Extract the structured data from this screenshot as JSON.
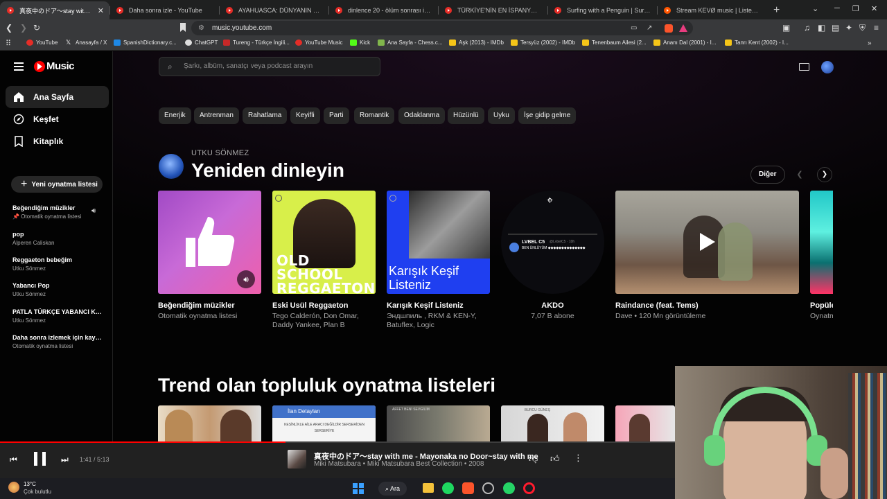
{
  "browser": {
    "tabs": [
      {
        "title": "真夜中のドア〜stay with me",
        "active": true
      },
      {
        "title": "Daha sonra izle - YouTube"
      },
      {
        "title": "AYAHUASCA: DÜNYANIN EN GÜÇLÜ"
      },
      {
        "title": "dinlence 20 - ölüm sonrası ihtimalle"
      },
      {
        "title": "TÜRKİYE'NİN EN İSPANYOL FUTBOL"
      },
      {
        "title": "Surfing with a Penguin | Surf's Up fo"
      },
      {
        "title": "Stream KEVØ music | Listen to song"
      }
    ],
    "new_tab": "+",
    "url": "music.youtube.com",
    "bookmarks": [
      {
        "label": "YouTube",
        "color": "#e52d27"
      },
      {
        "label": "Anasayfa / X",
        "color": "#000000"
      },
      {
        "label": "SpanishDictionary.c...",
        "color": "#1e88e5"
      },
      {
        "label": "ChatGPT",
        "color": "#dddddd"
      },
      {
        "label": "Tureng - Türkçe İngili...",
        "color": "#c62828"
      },
      {
        "label": "YouTube Music",
        "color": "#e52d27"
      },
      {
        "label": "Kick",
        "color": "#53fc18"
      },
      {
        "label": "Ana Sayfa - Chess.c...",
        "color": "#81b64c"
      },
      {
        "label": "Aşk (2013) - IMDb",
        "color": "#f5c518"
      },
      {
        "label": "Tersyüz (2002) - IMDb",
        "color": "#f5c518"
      },
      {
        "label": "Tenenbaum Ailesi (2...",
        "color": "#f5c518"
      },
      {
        "label": "Ananı Dal (2001) - I...",
        "color": "#f5c518"
      },
      {
        "label": "Tanrı Kent (2002) - I...",
        "color": "#f5c518"
      }
    ]
  },
  "app": {
    "logo": "Music",
    "nav": [
      {
        "label": "Ana Sayfa",
        "icon": "home-icon",
        "active": true
      },
      {
        "label": "Keşfet",
        "icon": "explore-icon"
      },
      {
        "label": "Kitaplık",
        "icon": "library-icon"
      }
    ],
    "new_playlist": "Yeni oynatma listesi",
    "playlists": [
      {
        "title": "Beğendiğim müzikler",
        "subtitle": "Otomatik oynatma listesi"
      },
      {
        "title": "pop",
        "subtitle": "Alperen Caliskan"
      },
      {
        "title": "Reggaeton bebeğim",
        "subtitle": "Utku Sönmez"
      },
      {
        "title": "Yabancı Pop",
        "subtitle": "Utku Sönmez"
      },
      {
        "title": "PATLA TÜRKÇE YABANCI KA...",
        "subtitle": "Utku Sönmez"
      },
      {
        "title": "Daha sonra izlemek için kayd...",
        "subtitle": "Otomatik oynatma listesi"
      }
    ],
    "search_placeholder": "Şarkı, albüm, sanatçı veya podcast arayın",
    "chips": [
      "Enerjik",
      "Antrenman",
      "Rahatlama",
      "Keyifli",
      "Parti",
      "Romantik",
      "Odaklanma",
      "Hüzünlü",
      "Uyku",
      "İşe gidip gelme"
    ],
    "section1": {
      "user": "UTKU SÖNMEZ",
      "title": "Yeniden dinleyin",
      "more": "Diğer",
      "cards": [
        {
          "title": "Beğendiğim müzikler",
          "subtitle": "Otomatik oynatma listesi"
        },
        {
          "title": "Eski Usül Reggaeton",
          "subtitle": "Tego Calderón, Don Omar, Daddy Yankee, Plan B",
          "art_text": "OLD SCHOOL REGGAETON"
        },
        {
          "title": "Karışık Keşif Listeniz",
          "subtitle": "Эндшпиль , RKM & KEN-Y, Batuflex, Logic",
          "art_text": "Karışık Keşif Listeniz"
        },
        {
          "title": "AKDO",
          "subtitle": "7,07 B abone",
          "art_text": "LVBEL C5",
          "art_handle": "@LvbelC5 · 10h",
          "art_post": "BEN ÜNLÜYÜM ◆◆◆◆◆◆◆◆◆◆◆◆◆◆"
        },
        {
          "title": "Raindance (feat. Tems)",
          "subtitle": "Dave • 120 Mn görüntüleme"
        },
        {
          "title": "Popüle",
          "subtitle": "Oynatm"
        }
      ]
    },
    "section2": {
      "title": "Trend olan topluluk oynatma listeleri",
      "card2_header": "İlan Detayları",
      "card2_sub": "KESİNLİKLE AİLE ARACI DEĞİLDİR SERSERİDEN SERSERİYE",
      "card3_header": "AFFET BENİ SEVGİLİM",
      "card4_header": "BURCU GÜNEŞ"
    },
    "player": {
      "time": "1:41 / 5:13",
      "progress": 0.322,
      "title": "真夜中のドア〜stay with me - Mayonaka no Door~stay with me",
      "meta": "Miki Matsubara • Miki Matsubara Best Collection • 2008"
    }
  },
  "taskbar": {
    "weather_temp": "13°C",
    "weather_desc": "Çok bulutlu",
    "search": "Ara"
  }
}
